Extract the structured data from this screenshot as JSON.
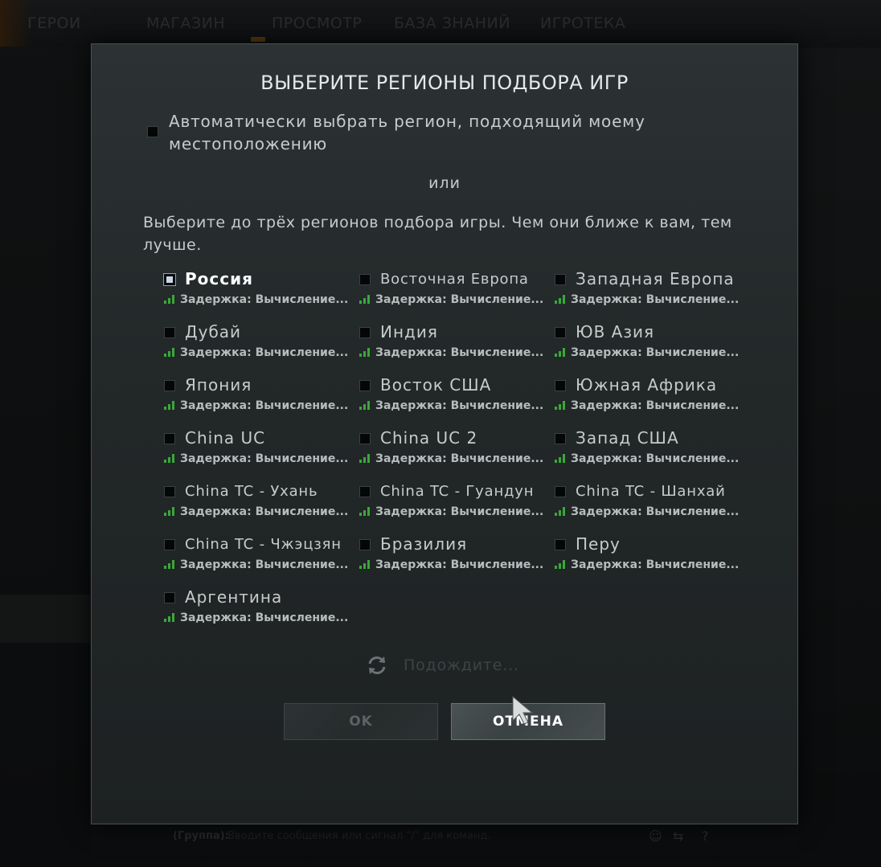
{
  "background": {
    "nav": [
      "ГЕРОИ",
      "МАГАЗИН",
      "ПРОСМОТР",
      "БАЗА ЗНАНИЙ",
      "ИГРОТЕКА"
    ],
    "chat_group": "(Группа):",
    "chat_placeholder": "Вводите сообщения или сигнал \"/\" для команд."
  },
  "dialog": {
    "title": "ВЫБЕРИТЕ РЕГИОНЫ ПОДБОРА ИГР",
    "auto_label": "Автоматически выбрать регион, подходящий моему местоположению",
    "or": "или",
    "instructions": "Выберите до трёх регионов подбора игры. Чем они ближе к вам, тем лучше.",
    "latency_text": "Задержка: Вычисление...",
    "regions": [
      {
        "name": "Россия",
        "selected": true
      },
      {
        "name": "Восточная Европа"
      },
      {
        "name": "Западная Европа"
      },
      {
        "name": "Дубай"
      },
      {
        "name": "Индия"
      },
      {
        "name": "ЮВ Азия"
      },
      {
        "name": "Япония"
      },
      {
        "name": "Восток США"
      },
      {
        "name": "Южная Африка"
      },
      {
        "name": "China UC"
      },
      {
        "name": "China UC 2"
      },
      {
        "name": "Запад США"
      },
      {
        "name": "China TC - Ухань"
      },
      {
        "name": "China TC - Гуандун"
      },
      {
        "name": "China TC - Шанхай"
      },
      {
        "name": "China TC - Чжэцзян"
      },
      {
        "name": "Бразилия"
      },
      {
        "name": "Перу"
      },
      {
        "name": "Аргентина"
      }
    ],
    "wait_text": "Подождите...",
    "ok_label": "OK",
    "cancel_label": "ОТМЕНА"
  },
  "colors": {
    "signal": "#3aa83a",
    "dialog_bg": "#262b2c",
    "text": "#c6cbcc"
  }
}
